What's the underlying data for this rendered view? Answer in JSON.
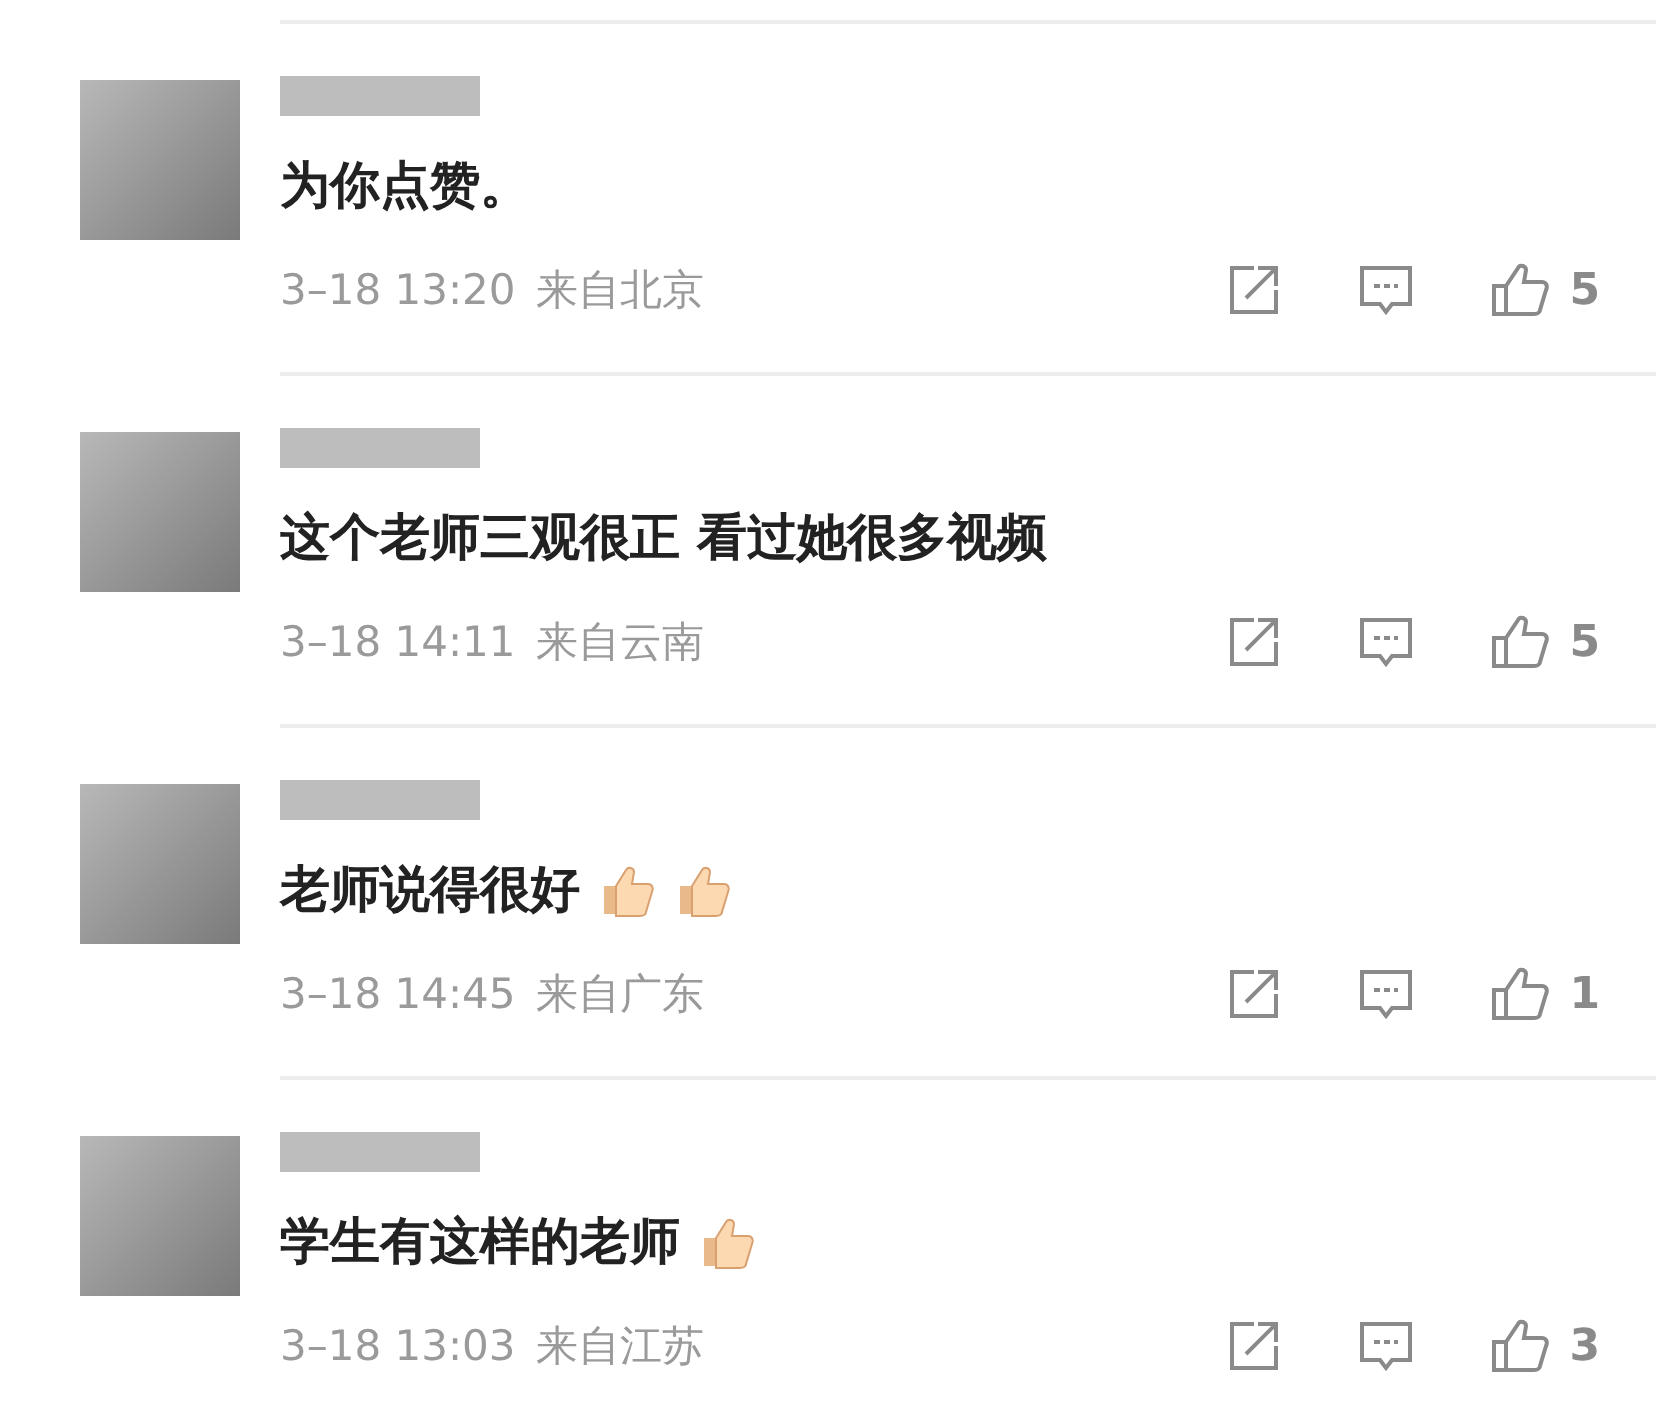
{
  "comments": [
    {
      "text": "为你点赞。",
      "time": "3–18 13:20",
      "location": "来自北京",
      "likes": "5"
    },
    {
      "text": "这个老师三观很正 看过她很多视频",
      "time": "3–18 14:11",
      "location": "来自云南",
      "likes": "5"
    },
    {
      "text": "老师说得很好",
      "emojis": [
        {
          "kind": "thumbs_up"
        },
        {
          "kind": "thumbs_up"
        }
      ],
      "time": "3–18 14:45",
      "location": "来自广东",
      "likes": "1"
    },
    {
      "text": "学生有这样的老师",
      "emojis": [
        {
          "kind": "thumbs_up"
        }
      ],
      "time": "3–18 13:03",
      "location": "来自江苏",
      "likes": "3"
    }
  ]
}
